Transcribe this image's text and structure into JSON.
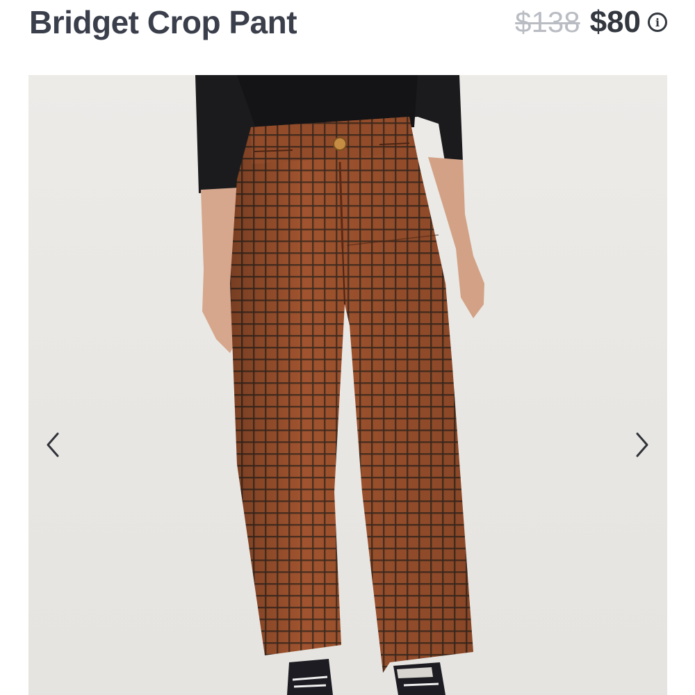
{
  "product": {
    "title": "Bridget Crop Pant",
    "original_price": "$138",
    "sale_price": "$80",
    "info_icon": "info-icon"
  },
  "gallery": {
    "image_subject": "brown-plaid-crop-pants",
    "prev_icon": "chevron-left-icon",
    "next_icon": "chevron-right-icon"
  },
  "colors": {
    "title": "#3a3f4b",
    "strikethrough_price": "#b9bcc3",
    "sale_price": "#33373f",
    "pant_fabric": "#9b4f2c",
    "grid_lines": "#3a2a1e"
  }
}
